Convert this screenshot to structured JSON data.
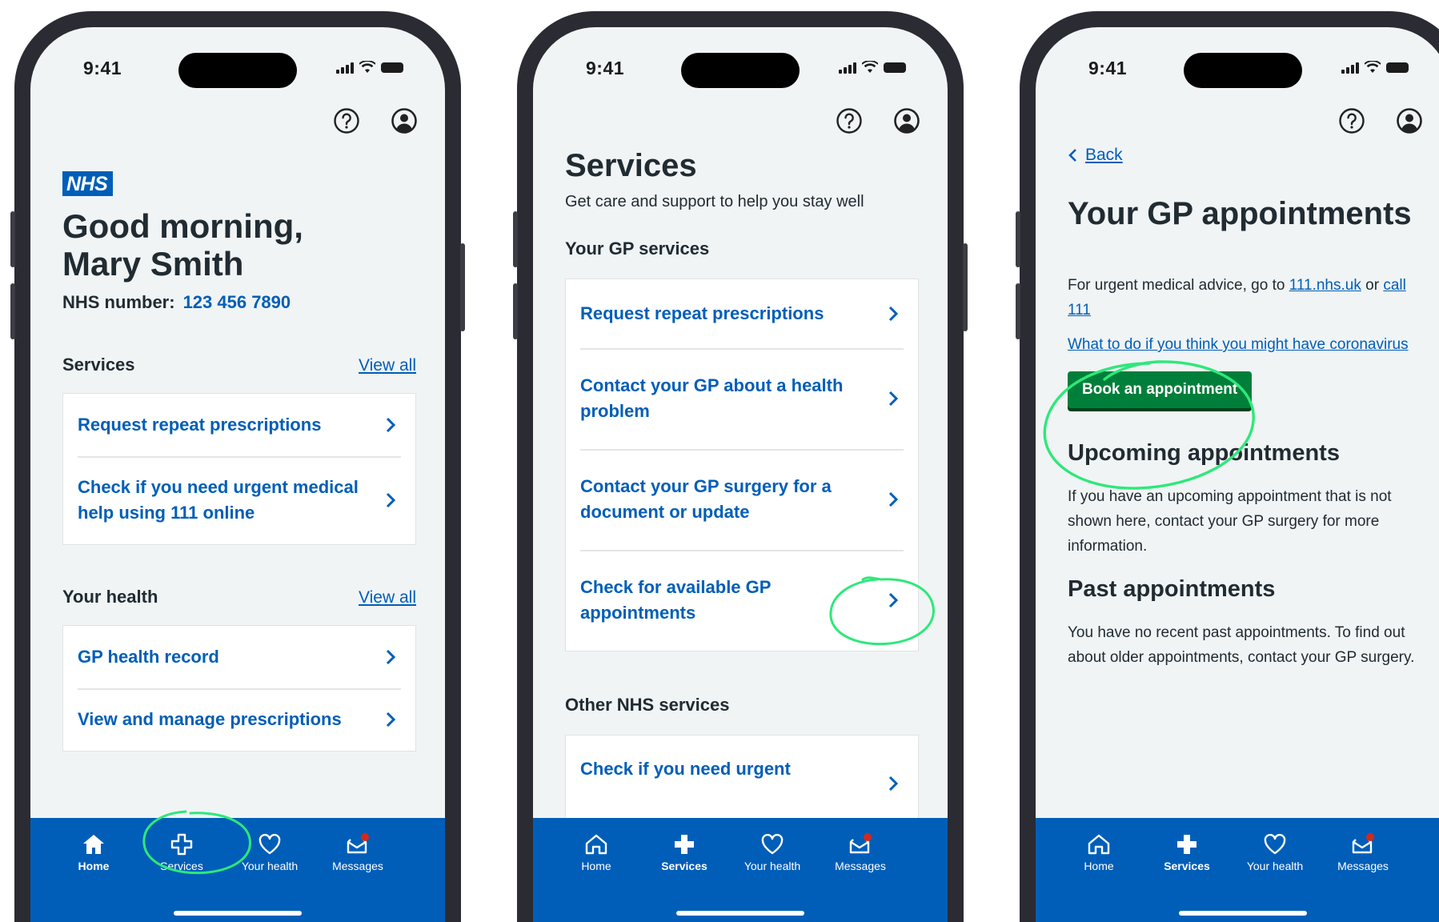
{
  "status_time": "9:41",
  "phones": [
    {
      "logo": "NHS",
      "greeting": "Good morning,",
      "user_name": "Mary Smith",
      "nhs_number_label": "NHS number:",
      "nhs_number_value": "123 456 7890",
      "services_section": {
        "title": "Services",
        "view_all": "View all",
        "items": [
          "Request repeat prescriptions",
          "Check if you need urgent medical help using 111 online"
        ]
      },
      "health_section": {
        "title": "Your health",
        "view_all": "View all",
        "items": [
          "GP health record",
          "View and manage prescriptions"
        ]
      }
    },
    {
      "title": "Services",
      "subtitle": "Get care and support to help you stay well",
      "gp_section_title": "Your GP services",
      "gp_items": [
        "Request repeat prescriptions",
        "Contact your GP about a health problem",
        "Contact your GP surgery for a document or update",
        "Check for available GP appointments"
      ],
      "other_section_title": "Other NHS services",
      "other_items": [
        "Check if you need urgent"
      ]
    },
    {
      "back_label": "Back",
      "title": "Your GP appointments",
      "urgent_text_before": "For urgent medical advice, go to",
      "urgent_link": "111.nhs.uk",
      "urgent_text_mid": "or",
      "urgent_call_link": "call 111",
      "coronavirus_link": "What to do if you think you might have coronavirus",
      "book_button": "Book an appointment",
      "upcoming_title": "Upcoming appointments",
      "upcoming_text": "If you have an upcoming appointment that is not shown here, contact your GP surgery for more information.",
      "past_title": "Past appointments",
      "past_text": "You have no recent past appointments. To find out about older appointments, contact your GP surgery."
    }
  ],
  "tabs": {
    "home": "Home",
    "services": "Services",
    "health": "Your health",
    "messages": "Messages"
  },
  "colors": {
    "nhs_blue": "#005eb8",
    "button_green": "#007f3b",
    "annotation_green": "#2ee87a",
    "notification_red": "#d5281b"
  },
  "icons": [
    "help-icon",
    "account-icon",
    "chevron-right-icon",
    "chevron-left-icon",
    "home-icon",
    "services-cross-icon",
    "heart-icon",
    "messages-icon"
  ]
}
